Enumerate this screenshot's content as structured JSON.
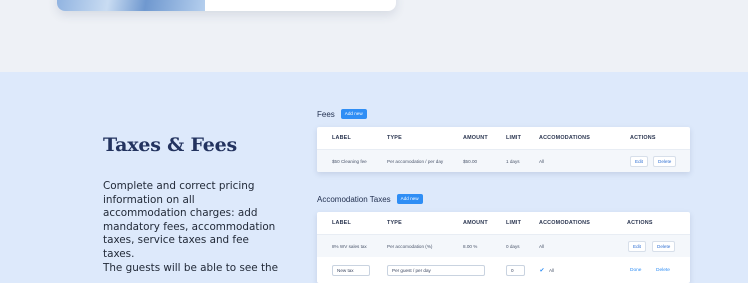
{
  "section": {
    "title": "Taxes & Fees",
    "description": "Complete and correct pricing information on all accommodation charges: add mandatory fees, accommodation taxes, service taxes and fee taxes.",
    "description2": "The guests will be able to see the"
  },
  "fees": {
    "title": "Fees",
    "add_label": "Add new",
    "columns": [
      "LABEL",
      "TYPE",
      "AMOUNT",
      "LIMIT",
      "ACCOMODATIONS",
      "ACTIONS"
    ],
    "rows": [
      {
        "label": "$50 Cleaning fee",
        "type": "Per accomodation / per day",
        "amount": "$50.00",
        "limit": "1 days",
        "accomodations": "All",
        "edit": "Edit",
        "delete": "Delete"
      }
    ]
  },
  "taxes": {
    "title": "Accomodation Taxes",
    "add_label": "Add new",
    "columns": [
      "LABEL",
      "TYPE",
      "AMOUNT",
      "LIMIT",
      "ACCOMODATIONS",
      "ACTIONS"
    ],
    "rows": [
      {
        "label": "8% WV sales tax",
        "type": "Per accomodation (%)",
        "amount": "8.00 %",
        "limit": "0 days",
        "accomodations": "All",
        "edit": "Edit",
        "delete": "Delete"
      }
    ],
    "new_row": {
      "label_value": "New tax",
      "type_value": "Per guest / per day",
      "amount_value": "0",
      "accomodations": "All",
      "done": "Done",
      "delete": "Delete"
    }
  }
}
